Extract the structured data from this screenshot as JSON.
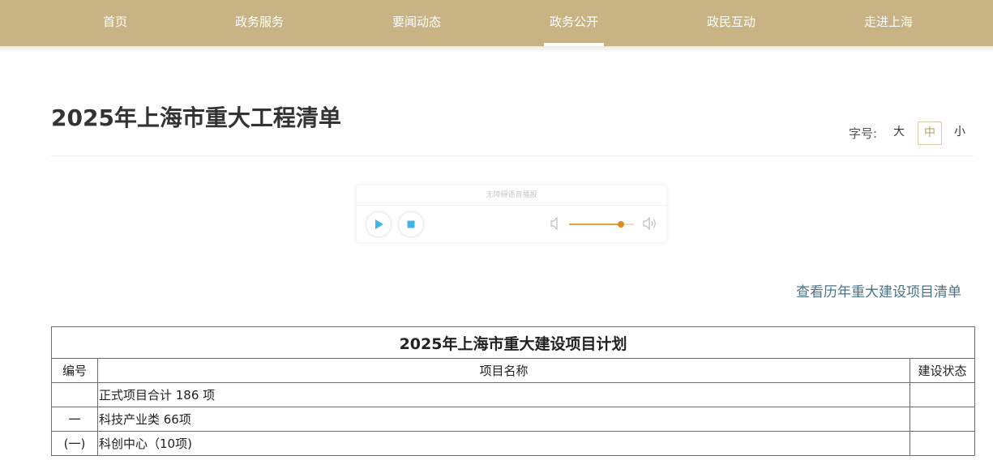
{
  "nav": {
    "items": [
      {
        "label": "首页",
        "active": false
      },
      {
        "label": "政务服务",
        "active": false
      },
      {
        "label": "要闻动态",
        "active": false
      },
      {
        "label": "政务公开",
        "active": true
      },
      {
        "label": "政民互动",
        "active": false
      },
      {
        "label": "走进上海",
        "active": false
      }
    ]
  },
  "article": {
    "title": "2025年上海市重大工程清单",
    "font_size": {
      "label": "字号:",
      "options": [
        {
          "label": "大",
          "active": false
        },
        {
          "label": "中",
          "active": true
        },
        {
          "label": "小",
          "active": false
        }
      ]
    }
  },
  "player": {
    "title": "无障碍语音播报",
    "volume_level": 0.8,
    "icons": [
      "play-icon",
      "stop-icon",
      "volume-low-icon",
      "volume-high-icon"
    ],
    "accent_color": "#3fb7e0",
    "volume_color": "#e3a23a"
  },
  "history_link": "查看历年重大建设项目清单",
  "table": {
    "caption": "2025年上海市重大建设项目计划",
    "headers": [
      "编号",
      "项目名称",
      "建设状态"
    ],
    "rows": [
      [
        "",
        "正式项目合计 186 项",
        ""
      ],
      [
        "一",
        "科技产业类 66项",
        ""
      ],
      [
        "(一)",
        "科创中心（10项)",
        ""
      ]
    ]
  },
  "colors": {
    "nav_bg": "#c8b384",
    "link": "#4b7386",
    "title": "#333333"
  }
}
